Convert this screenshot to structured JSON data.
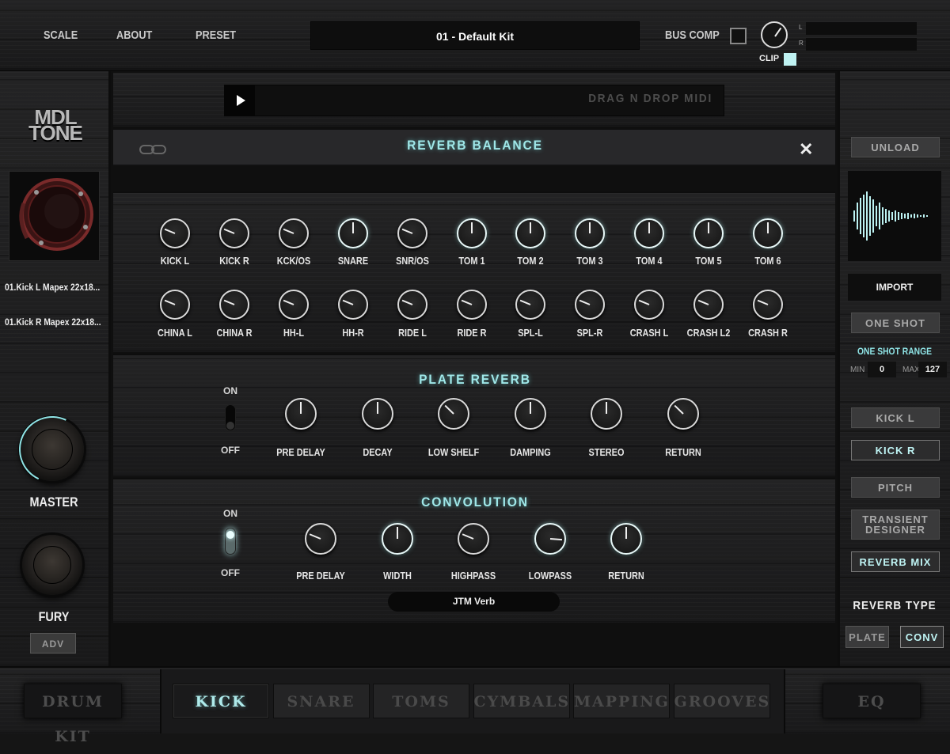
{
  "nav": {
    "scale": "SCALE",
    "about": "ABOUT",
    "preset": "PRESET"
  },
  "preset_name": "01 - Default Kit",
  "bus_comp": "BUS COMP",
  "clip": "CLIP",
  "meter_labels": {
    "l": "L",
    "r": "R"
  },
  "logo": {
    "line1": "MDL",
    "line2": "TONE"
  },
  "samples": [
    "01.Kick L Mapex 22x18...",
    "01.Kick R Mapex 22x18..."
  ],
  "master_label": "MASTER",
  "fury_label": "FURY",
  "adv_label": "ADV",
  "midi": {
    "drag_text": "DRAG N DROP MIDI"
  },
  "reverb_balance": {
    "title": "REVERB BALANCE",
    "row1": [
      {
        "label": "KICK L",
        "value": 0.25
      },
      {
        "label": "KICK R",
        "value": 0.25
      },
      {
        "label": "KCK/OS",
        "value": 0.25
      },
      {
        "label": "SNARE",
        "value": 0.5
      },
      {
        "label": "SNR/OS",
        "value": 0.25
      },
      {
        "label": "TOM 1",
        "value": 0.5
      },
      {
        "label": "TOM 2",
        "value": 0.5
      },
      {
        "label": "TOM 3",
        "value": 0.5
      },
      {
        "label": "TOM 4",
        "value": 0.5
      },
      {
        "label": "TOM 5",
        "value": 0.5
      },
      {
        "label": "TOM 6",
        "value": 0.5
      }
    ],
    "row2": [
      {
        "label": "CHINA L",
        "value": 0.25
      },
      {
        "label": "CHINA R",
        "value": 0.25
      },
      {
        "label": "HH-L",
        "value": 0.25
      },
      {
        "label": "HH-R",
        "value": 0.25
      },
      {
        "label": "RIDE L",
        "value": 0.25
      },
      {
        "label": "RIDE R",
        "value": 0.25
      },
      {
        "label": "SPL-L",
        "value": 0.25
      },
      {
        "label": "SPL-R",
        "value": 0.25
      },
      {
        "label": "CRASH L",
        "value": 0.25
      },
      {
        "label": "CRASH L2",
        "value": 0.25
      },
      {
        "label": "CRASH R",
        "value": 0.25
      }
    ]
  },
  "plate": {
    "title": "PLATE REVERB",
    "on_label": "ON",
    "off_label": "OFF",
    "enabled": false,
    "knobs": [
      {
        "label": "PRE DELAY",
        "value": 0.5
      },
      {
        "label": "DECAY",
        "value": 0.5
      },
      {
        "label": "LOW SHELF",
        "value": 0.33
      },
      {
        "label": "DAMPING",
        "value": 0.5
      },
      {
        "label": "STEREO",
        "value": 0.5
      },
      {
        "label": "RETURN",
        "value": 0.33
      }
    ]
  },
  "convolution": {
    "title": "CONVOLUTION",
    "on_label": "ON",
    "off_label": "OFF",
    "enabled": true,
    "knobs": [
      {
        "label": "PRE DELAY",
        "value": 0.25
      },
      {
        "label": "WIDTH",
        "value": 0.5
      },
      {
        "label": "HIGHPASS",
        "value": 0.25
      },
      {
        "label": "LOWPASS",
        "value": 0.85
      },
      {
        "label": "RETURN",
        "value": 0.5
      }
    ],
    "ir_name": "JTM Verb"
  },
  "right": {
    "unload": "UNLOAD",
    "import": "IMPORT",
    "one_shot": "ONE SHOT",
    "one_shot_range": "ONE SHOT RANGE",
    "min_label": "MIN",
    "max_label": "MAX",
    "min_value": "0",
    "max_value": "127",
    "kick_l": "KICK L",
    "kick_r": "KICK R",
    "pitch": "PITCH",
    "transient_1": "TRANSIENT",
    "transient_2": "DESIGNER",
    "reverb_mix": "REVERB MIX",
    "reverb_type": "REVERB TYPE",
    "plate": "PLATE",
    "conv": "CONV"
  },
  "bottom": {
    "drum_kit": "DRUM KIT",
    "tabs": [
      "KICK",
      "SNARE",
      "TOMS",
      "CYMBALS",
      "MAPPING",
      "GROOVES"
    ],
    "active_tab": "KICK",
    "eq": "EQ"
  },
  "colors": {
    "accent": "#9fe7e8",
    "clip_indicator": "#bff2f2"
  }
}
